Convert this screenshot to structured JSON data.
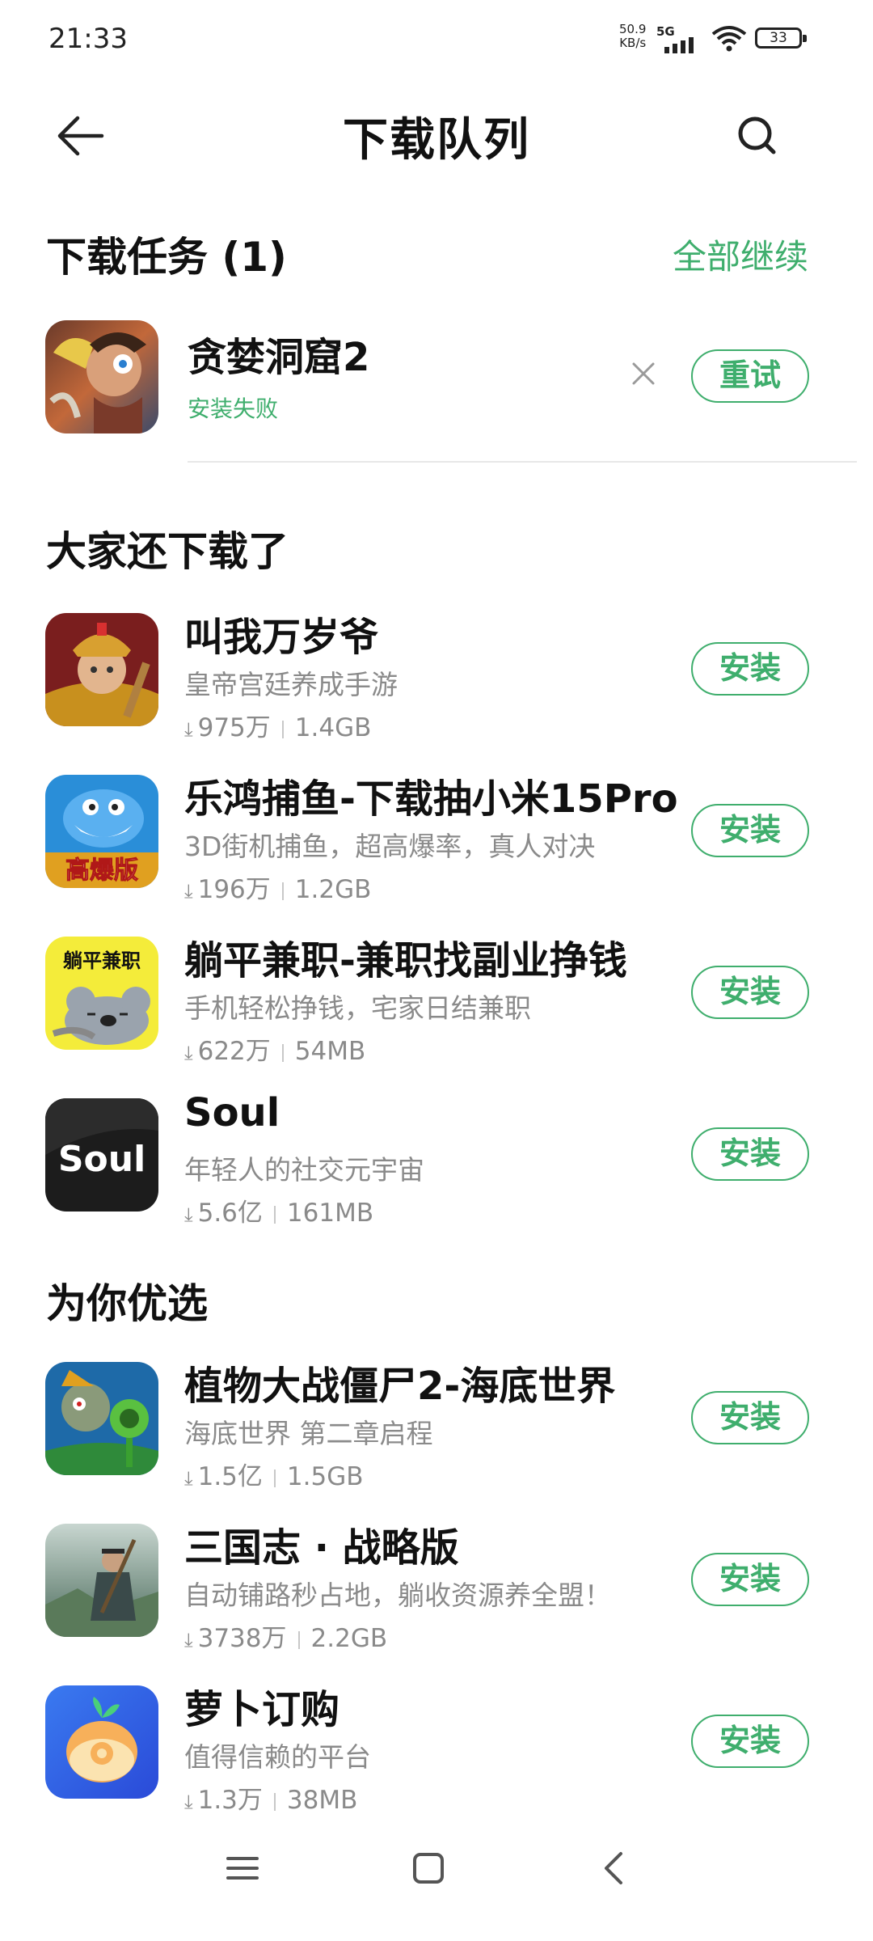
{
  "status": {
    "time": "21:33",
    "net_speed": "50.9",
    "net_unit": "KB/s",
    "network": "5G",
    "battery": "33"
  },
  "header": {
    "title": "下载队列",
    "back_icon": "back-arrow-icon",
    "search_icon": "search-icon"
  },
  "download_tasks": {
    "title": "下载任务 (1)",
    "action": "全部继续",
    "items": [
      {
        "name": "贪婪洞窟2",
        "status": "安装失败",
        "button": "重试"
      }
    ]
  },
  "also_downloaded": {
    "title": "大家还下载了",
    "items": [
      {
        "name": "叫我万岁爷",
        "desc": "皇帝宫廷养成手游",
        "downloads": "975万",
        "size": "1.4GB",
        "button": "安装"
      },
      {
        "name": "乐鸿捕鱼-下载抽小米15Pro",
        "desc": "3D街机捕鱼，超高爆率，真人对决",
        "downloads": "196万",
        "size": "1.2GB",
        "button": "安装"
      },
      {
        "name": "躺平兼职-兼职找副业挣钱",
        "desc": "手机轻松挣钱，宅家日结兼职",
        "downloads": "622万",
        "size": "54MB",
        "button": "安装"
      },
      {
        "name": "Soul",
        "desc": "年轻人的社交元宇宙",
        "downloads": "5.6亿",
        "size": "161MB",
        "button": "安装"
      }
    ]
  },
  "recommended": {
    "title": "为你优选",
    "items": [
      {
        "name": "植物大战僵尸2-海底世界",
        "desc": "海底世界 第二章启程",
        "downloads": "1.5亿",
        "size": "1.5GB",
        "button": "安装"
      },
      {
        "name": "三国志 · 战略版",
        "desc": "自动铺路秒占地，躺收资源养全盟！",
        "downloads": "3738万",
        "size": "2.2GB",
        "button": "安装"
      },
      {
        "name": "萝卜订购",
        "desc": "值得信赖的平台",
        "downloads": "1.3万",
        "size": "38MB",
        "button": "安装"
      }
    ]
  },
  "icon_text": {
    "tangping": "躺平兼职",
    "fishing": "高爆版",
    "soul": "Soul"
  },
  "colors": {
    "accent": "#3fae6d",
    "secondary_text": "#8a8a8a"
  },
  "navbar": {
    "menu_icon": "menu-icon",
    "home_icon": "home-icon",
    "back_icon": "back-icon"
  }
}
